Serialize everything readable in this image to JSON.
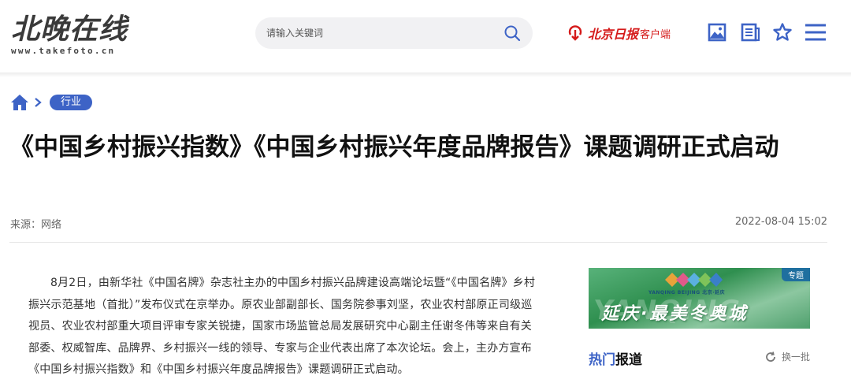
{
  "header": {
    "logo_main": "北晚在线",
    "logo_url": "www.takefoto.cn",
    "search_placeholder": "请输入关键词",
    "client_brand": "北京日报",
    "client_label": "客户端",
    "icons": [
      "search-icon",
      "download-icon",
      "image-icon",
      "newspaper-icon",
      "star-icon",
      "menu-icon"
    ],
    "accent_color": "#3d63c6",
    "brand_red": "#d51a1a"
  },
  "breadcrumb": {
    "tag": "行业"
  },
  "article": {
    "title": "《中国乡村振兴指数》《中国乡村振兴年度品牌报告》课题调研正式启动",
    "source": "来源：网络",
    "date": "2022-08-04 15:02",
    "paragraph": "8月2日，由新华社《中国名牌》杂志社主办的中国乡村振兴品牌建设高端论坛暨“《中国名牌》乡村振兴示范基地（首批）”发布仪式在京举办。原农业部副部长、国务院参事刘坚，农业农村部原正司级巡视员、农业农村部重大项目评审专家关锐捷，国家市场监管总局发展研究中心副主任谢冬伟等来自有关部委、权威智库、品牌界、乡村振兴一线的领导、专家与企业代表出席了本次论坛。会上，主办方宣布《中国乡村振兴指数》和《中国乡村振兴年度品牌报告》课题调研正式启动。"
  },
  "sidebar": {
    "promo": {
      "tag": "专题",
      "logo_text": "YANQING BEIJING 北京·延庆",
      "ghost_text": "YANQING",
      "headline": "延庆·最美冬奥城"
    },
    "hot": {
      "title_highlight": "热门",
      "title_rest": "报道",
      "refresh_label": "换一批"
    }
  }
}
